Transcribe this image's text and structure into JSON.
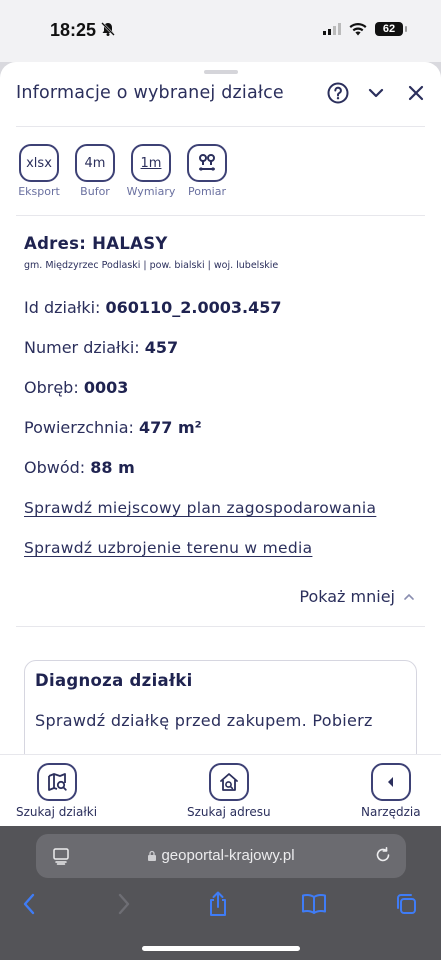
{
  "status_bar": {
    "time": "18:25",
    "battery": "62"
  },
  "sheet": {
    "title": "Informacje o wybranej działce",
    "tools": [
      {
        "icon": "xlsx",
        "label": "Eksport"
      },
      {
        "icon": "4m",
        "label": "Bufor"
      },
      {
        "icon": "1m",
        "label": "Wymiary"
      },
      {
        "icon": "pin-pair-icon",
        "label": "Pomiar"
      }
    ],
    "address": "Adres: HALASY",
    "address_sub": "gm. Międzyrzec Podlaski | pow. bialski | woj. lubelskie",
    "fields": [
      {
        "label": "Id działki: ",
        "value": "060110_2.0003.457"
      },
      {
        "label": "Numer działki: ",
        "value": "457"
      },
      {
        "label": "Obręb: ",
        "value": "0003"
      },
      {
        "label": "Powierzchnia: ",
        "value": "477 m²"
      },
      {
        "label": "Obwód: ",
        "value": "88 m"
      }
    ],
    "links": [
      "Sprawdź miejscowy plan zagospodarowania",
      "Sprawdź uzbrojenie terenu w media"
    ],
    "show_less": "Pokaż mniej",
    "diagnosis": {
      "title": "Diagnoza działki",
      "text": "Sprawdź działkę przed zakupem. Pobierz"
    }
  },
  "bottom_nav": [
    {
      "label": "Szukaj działki",
      "icon": "map-search-icon"
    },
    {
      "label": "Szukaj adresu",
      "icon": "house-search-icon"
    },
    {
      "label": "Narzędzia",
      "icon": "chevron-left-icon"
    }
  ],
  "browser": {
    "url": "geoportal-krajowy.pl"
  },
  "colors": {
    "accent": "#2b2f5c",
    "browser_bar": "#545458",
    "browser_field": "#6b6b70",
    "browser_blue": "#3f7cf6"
  }
}
